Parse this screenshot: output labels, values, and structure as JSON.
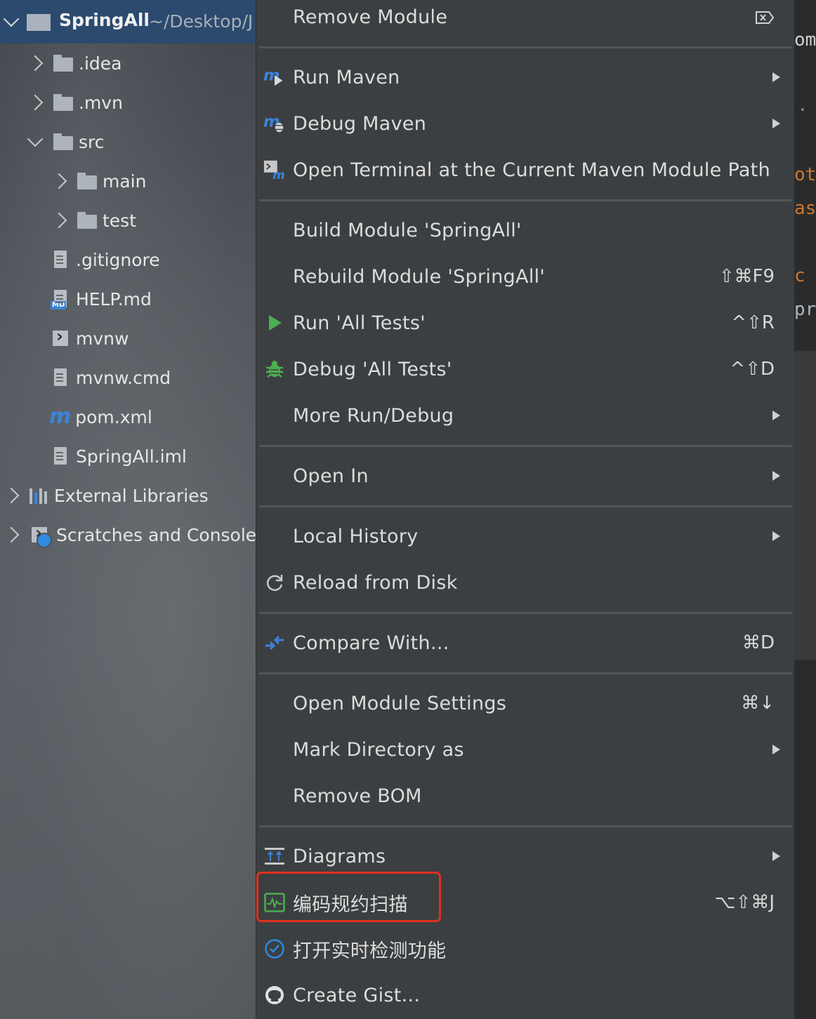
{
  "project_tree": {
    "root": {
      "name": "SpringAll",
      "path": "~/Desktop/J"
    },
    "items": [
      {
        "label": ".idea"
      },
      {
        "label": ".mvn"
      },
      {
        "label": "src"
      },
      {
        "label": "main"
      },
      {
        "label": "test"
      },
      {
        "label": ".gitignore"
      },
      {
        "label": "HELP.md"
      },
      {
        "label": "mvnw"
      },
      {
        "label": "mvnw.cmd"
      },
      {
        "label": "pom.xml"
      },
      {
        "label": "SpringAll.iml"
      },
      {
        "label": "External Libraries"
      },
      {
        "label": "Scratches and Console"
      }
    ]
  },
  "context_menu": {
    "items": [
      {
        "label": "Remove Module",
        "icon": "remove-module-icon"
      },
      {
        "label": "Run Maven",
        "icon": "maven-run-icon",
        "submenu": true
      },
      {
        "label": "Debug Maven",
        "icon": "maven-debug-icon",
        "submenu": true
      },
      {
        "label": "Open Terminal at the Current Maven Module Path",
        "icon": "terminal-maven-icon"
      },
      {
        "label": "Build Module 'SpringAll'"
      },
      {
        "label": "Rebuild Module 'SpringAll'",
        "shortcut": "⇧⌘F9"
      },
      {
        "label": "Run 'All Tests'",
        "shortcut": "^⇧R",
        "icon": "run-icon"
      },
      {
        "label": "Debug 'All Tests'",
        "shortcut": "^⇧D",
        "icon": "debug-bug-icon"
      },
      {
        "label": "More Run/Debug",
        "submenu": true
      },
      {
        "label": "Open In",
        "submenu": true
      },
      {
        "label": "Local History",
        "submenu": true
      },
      {
        "label": "Reload from Disk",
        "icon": "reload-icon"
      },
      {
        "label": "Compare With...",
        "shortcut": "⌘D",
        "icon": "compare-icon"
      },
      {
        "label": "Open Module Settings",
        "shortcut": "⌘↓"
      },
      {
        "label": "Mark Directory as",
        "submenu": true
      },
      {
        "label": "Remove BOM"
      },
      {
        "label": "Diagrams",
        "submenu": true,
        "icon": "diagram-icon"
      },
      {
        "label": "编码规约扫描",
        "shortcut": "⌥⇧⌘J",
        "icon": "code-scan-icon",
        "highlighted": true
      },
      {
        "label": "打开实时检测功能",
        "icon": "realtime-check-icon"
      },
      {
        "label": "Create Gist...",
        "icon": "github-icon"
      }
    ]
  },
  "editor_fragments": [
    "om",
    "·",
    "ot",
    "as",
    "c",
    "pr"
  ],
  "colors": {
    "menu_bg": "#3c3f41",
    "highlight_border": "#e0301e",
    "accent_blue": "#3b84d9",
    "run_green": "#4caf50",
    "orange_keyword": "#cc7832"
  }
}
